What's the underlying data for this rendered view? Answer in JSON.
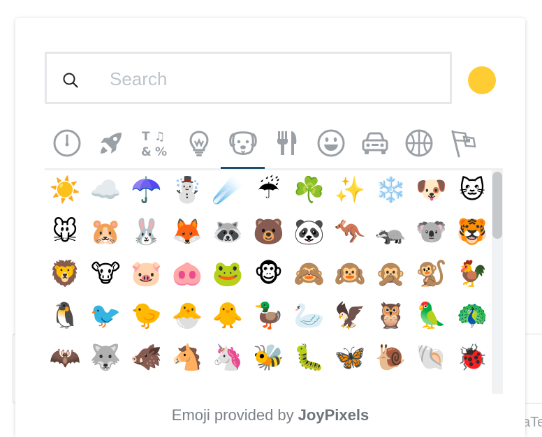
{
  "search": {
    "placeholder": "Search"
  },
  "skin_tone": {
    "color": "#ffcc33"
  },
  "categories": [
    {
      "icon": "recent-clock-icon"
    },
    {
      "icon": "rocket-icon"
    },
    {
      "icon": "symbols-icon"
    },
    {
      "icon": "lightbulb-icon"
    },
    {
      "icon": "dog-face-icon",
      "active": true
    },
    {
      "icon": "fork-knife-icon"
    },
    {
      "icon": "smiley-icon"
    },
    {
      "icon": "car-icon"
    },
    {
      "icon": "basketball-icon"
    },
    {
      "icon": "flags-icon"
    }
  ],
  "emoji_rows": [
    [
      "☀️",
      "☁️",
      "☂️",
      "☃️",
      "☄️",
      "☔",
      "☘️",
      "✨",
      "❄️",
      "🐶",
      "🐱"
    ],
    [
      "🐭",
      "🐹",
      "🐰",
      "🦊",
      "🦝",
      "🐻",
      "🐼",
      "🦘",
      "🦡",
      "🐨",
      "🐯"
    ],
    [
      "🦁",
      "🐮",
      "🐷",
      "🐽",
      "🐸",
      "🐵",
      "🙈",
      "🙉",
      "🙊",
      "🐒",
      "🐓"
    ],
    [
      "🐧",
      "🐦",
      "🐤",
      "🐣",
      "🐥",
      "🦆",
      "🦢",
      "🦅",
      "🦉",
      "🦜",
      "🦚"
    ],
    [
      "🦇",
      "🐺",
      "🐗",
      "🐴",
      "🦄",
      "🐝",
      "🐛",
      "🦋",
      "🐌",
      "🐚",
      "🐞"
    ]
  ],
  "footer": {
    "prefix": "Emoji provided by",
    "brand": "JoyPixels"
  },
  "background": {
    "partial_text": "aTe"
  }
}
